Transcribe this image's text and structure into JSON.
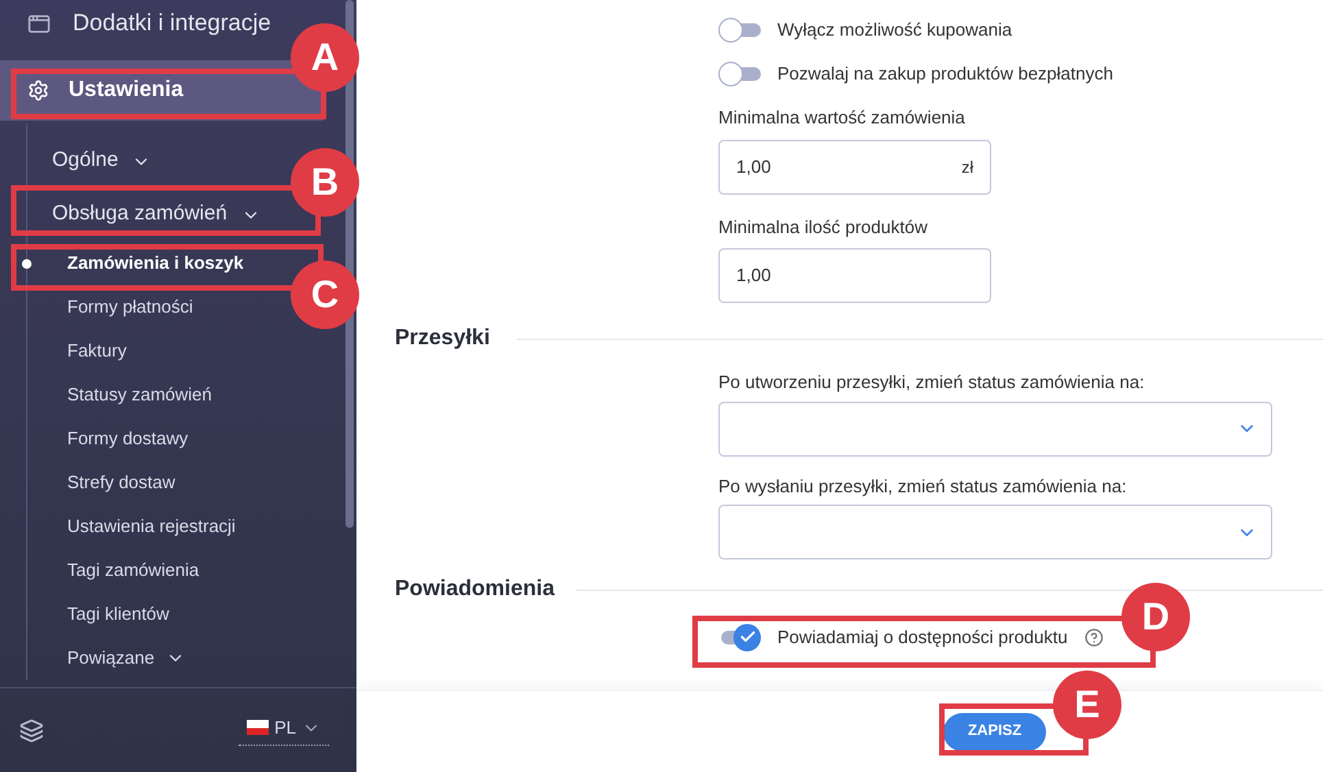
{
  "sidebar": {
    "top_item": {
      "label": "Dodatki i integracje"
    },
    "section": {
      "label": "Ustawienia",
      "selected": true
    },
    "groups": [
      {
        "label": "Ogólne"
      },
      {
        "label": "Obsługa zamówień"
      }
    ],
    "items": [
      {
        "label": "Zamówienia i koszyk",
        "selected": true
      },
      {
        "label": "Formy płatności",
        "selected": false
      },
      {
        "label": "Faktury",
        "selected": false
      },
      {
        "label": "Statusy zamówień",
        "selected": false
      },
      {
        "label": "Formy dostawy",
        "selected": false
      },
      {
        "label": "Strefy dostaw",
        "selected": false
      },
      {
        "label": "Ustawienia rejestracji",
        "selected": false
      },
      {
        "label": "Tagi zamówienia",
        "selected": false
      },
      {
        "label": "Tagi klientów",
        "selected": false
      },
      {
        "label": "Powiązane",
        "selected": false,
        "kind": "group"
      }
    ],
    "language": "PL"
  },
  "purchase": {
    "toggles": [
      {
        "label": "Wyłącz możliwość kupowania",
        "on": false
      },
      {
        "label": "Pozwalaj na zakup produktów bezpłatnych",
        "on": false
      }
    ],
    "fields": [
      {
        "label": "Minimalna wartość zamówienia",
        "value": "1,00",
        "suffix": "zł"
      },
      {
        "label": "Minimalna ilość produktów",
        "value": "1,00"
      }
    ]
  },
  "shipping": {
    "title": "Przesyłki",
    "selects": [
      {
        "label": "Po utworzeniu przesyłki, zmień status zamówienia na:"
      },
      {
        "label": "Po wysłaniu przesyłki, zmień status zamówienia na:"
      }
    ]
  },
  "notifications": {
    "title": "Powiadomienia",
    "toggle": {
      "label": "Powiadamiaj o dostępności produktu",
      "on": true
    }
  },
  "save_button": "ZAPISZ",
  "annotations": [
    {
      "letter": "A"
    },
    {
      "letter": "B"
    },
    {
      "letter": "C"
    },
    {
      "letter": "D"
    },
    {
      "letter": "E"
    }
  ]
}
